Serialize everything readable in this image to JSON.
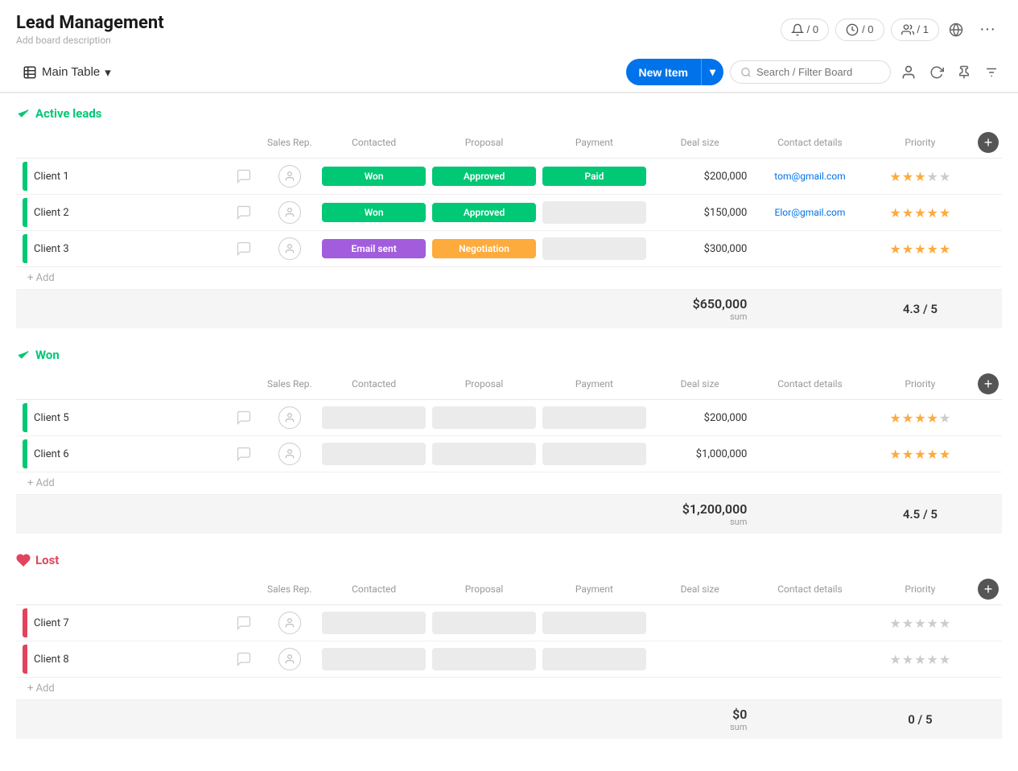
{
  "app": {
    "title": "Lead Management",
    "description": "Add board description"
  },
  "header_actions": {
    "bell": "🔔",
    "bell_count": "/ 0",
    "clock": "🕐",
    "clock_count": "/ 0",
    "person": "👤",
    "person_count": "/ 1",
    "globe_icon": "🌐",
    "more": "···"
  },
  "toolbar": {
    "table_icon": "⊞",
    "main_table": "Main Table",
    "new_item": "New Item",
    "search_placeholder": "Search / Filter Board"
  },
  "groups": [
    {
      "id": "active_leads",
      "name": "Active leads",
      "color": "#00c875",
      "icon_type": "check",
      "columns": [
        "Sales Rep.",
        "Contacted",
        "Proposal",
        "Payment",
        "Deal size",
        "Contact details",
        "Priority"
      ],
      "rows": [
        {
          "name": "Client 1",
          "color": "#00c875",
          "contacted": "Won",
          "contacted_style": "won",
          "proposal": "Approved",
          "proposal_style": "approved",
          "payment": "Paid",
          "payment_style": "paid",
          "deal_size": "$200,000",
          "contact": "tom@gmail.com",
          "priority": 3.5,
          "stars_filled": 3,
          "stars_half": false,
          "stars_empty": 2
        },
        {
          "name": "Client 2",
          "color": "#00c875",
          "contacted": "Won",
          "contacted_style": "won",
          "proposal": "Approved",
          "proposal_style": "approved",
          "payment": "",
          "payment_style": "empty",
          "deal_size": "$150,000",
          "contact": "Elor@gmail.com",
          "priority": 5,
          "stars_filled": 5,
          "stars_half": false,
          "stars_empty": 0
        },
        {
          "name": "Client 3",
          "color": "#00c875",
          "contacted": "Email sent",
          "contacted_style": "email",
          "proposal": "Negotiation",
          "proposal_style": "negotiation",
          "payment": "",
          "payment_style": "empty",
          "deal_size": "$300,000",
          "contact": "",
          "priority": 5,
          "stars_filled": 5,
          "stars_half": false,
          "stars_empty": 0
        }
      ],
      "summary": {
        "deal_total": "$650,000",
        "priority_avg": "4.3 / 5"
      }
    },
    {
      "id": "won",
      "name": "Won",
      "color": "#00c875",
      "icon_type": "check",
      "columns": [
        "Sales Rep.",
        "Contacted",
        "Proposal",
        "Payment",
        "Deal size",
        "Contact details",
        "Priority"
      ],
      "rows": [
        {
          "name": "Client 5",
          "color": "#00c875",
          "contacted": "",
          "contacted_style": "empty",
          "proposal": "",
          "proposal_style": "empty",
          "payment": "",
          "payment_style": "empty",
          "deal_size": "$200,000",
          "contact": "",
          "priority": 4,
          "stars_filled": 4,
          "stars_half": false,
          "stars_empty": 1
        },
        {
          "name": "Client 6",
          "color": "#00c875",
          "contacted": "",
          "contacted_style": "empty",
          "proposal": "",
          "proposal_style": "empty",
          "payment": "",
          "payment_style": "empty",
          "deal_size": "$1,000,000",
          "contact": "",
          "priority": 5,
          "stars_filled": 5,
          "stars_half": false,
          "stars_empty": 0
        }
      ],
      "summary": {
        "deal_total": "$1,200,000",
        "priority_avg": "4.5 / 5"
      }
    },
    {
      "id": "lost",
      "name": "Lost",
      "color": "#e2445c",
      "icon_type": "heart",
      "columns": [
        "Sales Rep.",
        "Contacted",
        "Proposal",
        "Payment",
        "Deal size",
        "Contact details",
        "Priority"
      ],
      "rows": [
        {
          "name": "Client 7",
          "color": "#e2445c",
          "contacted": "",
          "contacted_style": "empty",
          "proposal": "",
          "proposal_style": "empty",
          "payment": "",
          "payment_style": "empty",
          "deal_size": "",
          "contact": "",
          "priority": 0,
          "stars_filled": 0,
          "stars_half": false,
          "stars_empty": 5
        },
        {
          "name": "Client 8",
          "color": "#e2445c",
          "contacted": "",
          "contacted_style": "empty",
          "proposal": "",
          "proposal_style": "empty",
          "payment": "",
          "payment_style": "empty",
          "deal_size": "",
          "contact": "",
          "priority": 0,
          "stars_filled": 0,
          "stars_half": false,
          "stars_empty": 5
        }
      ],
      "summary": {
        "deal_total": "$0",
        "priority_avg": "0 / 5"
      }
    }
  ]
}
